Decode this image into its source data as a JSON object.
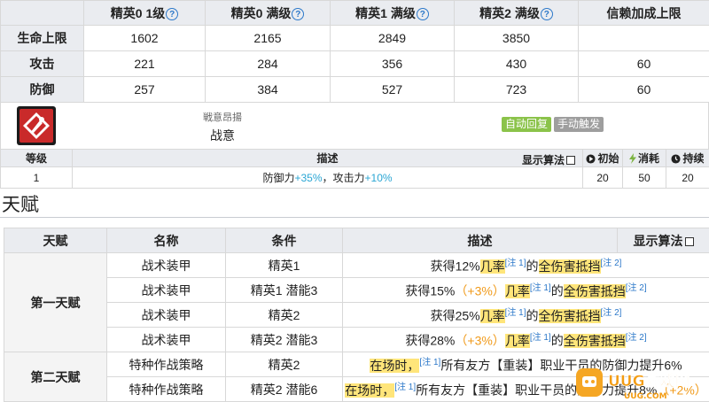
{
  "stats": {
    "headers": [
      "",
      "精英0 1级",
      "精英0 满级",
      "精英1 满级",
      "精英2 满级",
      "信赖加成上限"
    ],
    "rows": [
      {
        "label": "生命上限",
        "values": [
          "1602",
          "2165",
          "2849",
          "3850",
          ""
        ]
      },
      {
        "label": "攻击",
        "values": [
          "221",
          "284",
          "356",
          "430",
          "60"
        ]
      },
      {
        "label": "防御",
        "values": [
          "257",
          "384",
          "527",
          "723",
          "60"
        ]
      }
    ]
  },
  "skill": {
    "icon": "skill-flag-icon",
    "subtitle": "戦意昂揚",
    "name": "战意",
    "tags": [
      "自动回复",
      "手动触发"
    ],
    "table_headers": {
      "level": "等级",
      "desc": "描述",
      "show_algo": "显示算法",
      "initial": "初始",
      "cost": "消耗",
      "duration": "持续"
    },
    "row": {
      "level": "1",
      "desc_parts": [
        "防御力",
        "+35%",
        "，攻击力",
        "+10%"
      ],
      "initial": "20",
      "cost": "50",
      "duration": "20"
    }
  },
  "section_title": "天赋",
  "talent": {
    "headers": [
      "天赋",
      "名称",
      "条件",
      "描述",
      "显示算法"
    ],
    "groups": [
      {
        "name": "第一天赋",
        "rows": [
          {
            "name": "战术装甲",
            "cond": "精英1",
            "d1": "获得12%",
            "extra": "",
            "key1": "几率",
            "note1": "[注 1]",
            "mid": "的",
            "key2": "全伤害抵挡",
            "note2": "[注 2]"
          },
          {
            "name": "战术装甲",
            "cond": "精英1 潜能3",
            "d1": "获得15%",
            "extra": "（+3%）",
            "key1": "几率",
            "note1": "[注 1]",
            "mid": "的",
            "key2": "全伤害抵挡",
            "note2": "[注 2]"
          },
          {
            "name": "战术装甲",
            "cond": "精英2",
            "d1": "获得25%",
            "extra": "",
            "key1": "几率",
            "note1": "[注 1]",
            "mid": "的",
            "key2": "全伤害抵挡",
            "note2": "[注 2]"
          },
          {
            "name": "战术装甲",
            "cond": "精英2 潜能3",
            "d1": "获得28%",
            "extra": "（+3%）",
            "key1": "几率",
            "note1": "[注 1]",
            "mid": "的",
            "key2": "全伤害抵挡",
            "note2": "[注 2]"
          }
        ]
      },
      {
        "name": "第二天赋",
        "rows": [
          {
            "name": "特种作战策略",
            "cond": "精英2",
            "key1": "在场时，",
            "note1": "[注 1]",
            "rest": "所有友方【重装】职业干员的防御力提升6%"
          },
          {
            "name": "特种作战策略",
            "cond": "精英2 潜能6",
            "key1": "在场时，",
            "note1": "[注 1]",
            "rest": "所有友方【重装】职业干员的防御力提升8%",
            "extra": "（+2%）"
          }
        ]
      }
    ]
  },
  "watermark": {
    "logo_text": "UUG游戏网",
    "logo_domain": "UUG.COM"
  },
  "colors": {
    "header_bg": "#eaecf0",
    "highlight_blue": "#2aa6d4",
    "highlight_yellow": "#ffe57a",
    "orange": "#f09a1a",
    "tag_auto": "#8bc34a",
    "tag_manual": "#9e9e9e"
  }
}
